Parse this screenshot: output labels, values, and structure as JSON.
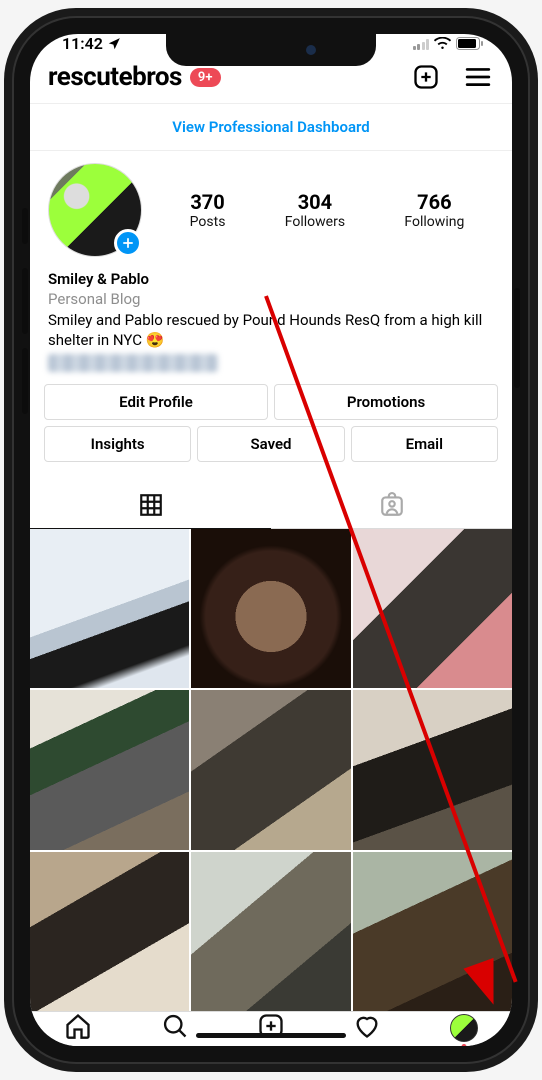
{
  "status": {
    "time": "11:42"
  },
  "header": {
    "username": "rescutebros",
    "badge": "9+"
  },
  "dashboard": {
    "link": "View Professional Dashboard"
  },
  "stats": {
    "posts": {
      "num": "370",
      "label": "Posts"
    },
    "followers": {
      "num": "304",
      "label": "Followers"
    },
    "following": {
      "num": "766",
      "label": "Following"
    }
  },
  "bio": {
    "name": "Smiley & Pablo",
    "category": "Personal Blog",
    "text": "Smiley and Pablo rescued by Pound Hounds ResQ from a high kill shelter in NYC 😍"
  },
  "buttons": {
    "edit": "Edit Profile",
    "promotions": "Promotions",
    "insights": "Insights",
    "saved": "Saved",
    "email": "Email"
  }
}
